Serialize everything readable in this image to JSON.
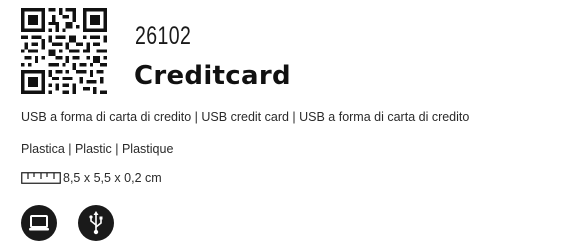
{
  "product": {
    "code": "26102",
    "title": "Creditcard",
    "description": "USB a forma di carta di credito | USB credit card | USB a forma di carta di credito",
    "material": "Plastica | Plastic | Plastique",
    "dimensions": "8,5 x 5,5 x 0,2 cm"
  },
  "icons": {
    "qr": "qr-code-icon",
    "ruler": "ruler-icon",
    "laptop": "laptop-icon",
    "usb": "usb-icon"
  },
  "colors": {
    "text": "#1a1a1a",
    "icon_bg": "#1a1a1a",
    "background": "#ffffff"
  }
}
